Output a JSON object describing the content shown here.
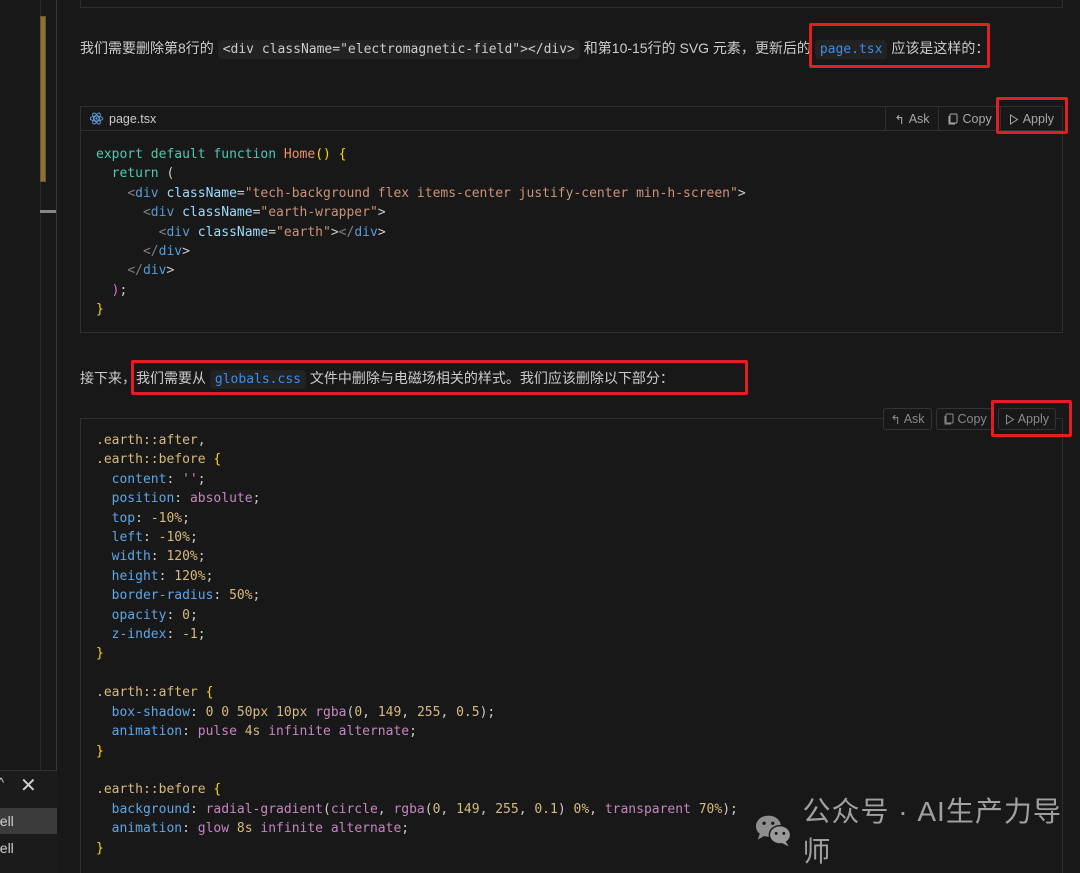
{
  "sidebar": {
    "panel_close_glyph": "✕",
    "panel_chevron_glyph": "^",
    "terminals": [
      {
        "label": "hell",
        "active": true
      },
      {
        "label": "hell",
        "active": false
      }
    ]
  },
  "paragraph1": {
    "before_code": "我们需要删除第8行的 ",
    "inline_code": "<div className=\"electromagnetic-field\"></div>",
    "middle": " 和第10-15行的 SVG 元素，",
    "highlight_text": "更新后的 ",
    "file_link": "page.tsx",
    "after": " 应该是这样的："
  },
  "code_block_1": {
    "filename": "page.tsx",
    "file_icon": "react-icon",
    "actions": [
      {
        "label": "Ask",
        "icon": "reply-arrow-icon"
      },
      {
        "label": "Copy",
        "icon": "copy-icon"
      },
      {
        "label": "Apply",
        "icon": "play-icon"
      }
    ],
    "lines": [
      "export default function Home() {",
      "  return (",
      "    <div className=\"tech-background flex items-center justify-center min-h-screen\">",
      "      <div className=\"earth-wrapper\">",
      "        <div className=\"earth\"></div>",
      "      </div>",
      "    </div>",
      "  );",
      "}"
    ]
  },
  "paragraph2": {
    "prefix": "接下来，",
    "highlight_before": "我们需要从 ",
    "file_link": "globals.css",
    "highlight_after": " 文件中删除与电磁场相关的样式。我们应该删除以下部分："
  },
  "code_block_2": {
    "actions": [
      {
        "label": "Ask",
        "icon": "reply-arrow-icon"
      },
      {
        "label": "Copy",
        "icon": "copy-icon"
      },
      {
        "label": "Apply",
        "icon": "play-icon"
      }
    ],
    "lines": [
      ".earth::after,",
      ".earth::before {",
      "  content: '';",
      "  position: absolute;",
      "  top: -10%;",
      "  left: -10%;",
      "  width: 120%;",
      "  height: 120%;",
      "  border-radius: 50%;",
      "  opacity: 0;",
      "  z-index: -1;",
      "}",
      "",
      ".earth::after {",
      "  box-shadow: 0 0 50px 10px rgba(0, 149, 255, 0.5);",
      "  animation: pulse 4s infinite alternate;",
      "}",
      "",
      ".earth::before {",
      "  background: radial-gradient(circle, rgba(0, 149, 255, 0.1) 0%, transparent 70%);",
      "  animation: glow 8s infinite alternate;",
      "}"
    ]
  },
  "watermark": {
    "text": "公众号 · AI生产力导师",
    "icon": "wechat-icon"
  },
  "colors": {
    "background": "#181818",
    "highlight_border": "#e11d26",
    "link": "#3b8eea",
    "scroll_thumb": "#8c6f3a"
  }
}
